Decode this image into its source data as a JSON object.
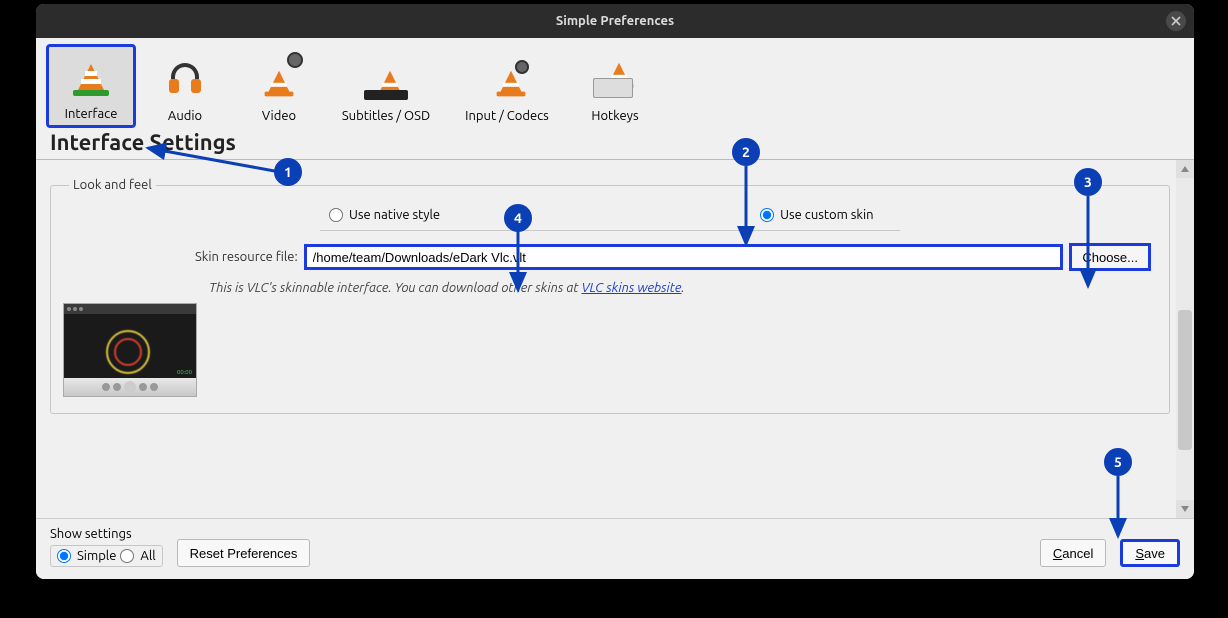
{
  "window": {
    "title": "Simple Preferences"
  },
  "tabs": {
    "interface": "Interface",
    "audio": "Audio",
    "video": "Video",
    "subtitles": "Subtitles / OSD",
    "input": "Input / Codecs",
    "hotkeys": "Hotkeys"
  },
  "heading": "Interface Settings",
  "look_and_feel": {
    "legend": "Look and feel",
    "native_label": "Use native style",
    "custom_label": "Use custom skin",
    "custom_selected": true,
    "skin_file_label": "Skin resource file:",
    "skin_file_value": "/home/team/Downloads/eDark Vlc.vlt",
    "choose_label": "Choose...",
    "hint_prefix": "This is VLC's skinnable interface. You can download other skins at ",
    "hint_link": "VLC skins website",
    "hint_suffix": "."
  },
  "bottom": {
    "show_settings": "Show settings",
    "simple": "Simple",
    "all": "All",
    "reset": "Reset Preferences",
    "cancel": "Cancel",
    "save": "Save"
  },
  "annotations": {
    "1": "1",
    "2": "2",
    "3": "3",
    "4": "4",
    "5": "5"
  }
}
